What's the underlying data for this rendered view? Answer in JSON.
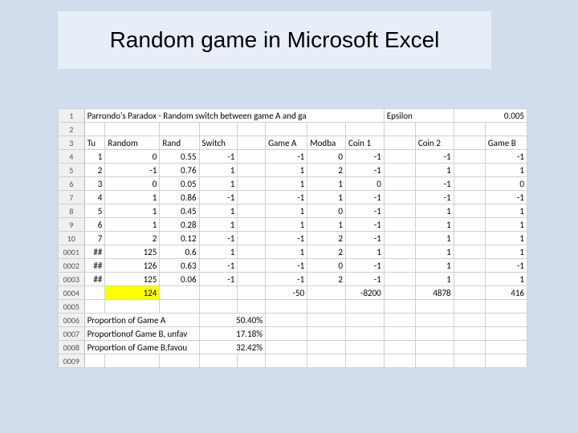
{
  "slide_title": "Random game in Microsoft Excel",
  "row1": {
    "title": "Parrondo's Paradox - Random switch between game A and ga",
    "eps_label": "Epsilon",
    "eps_value": "0.005"
  },
  "hdr": {
    "tu": "Tu",
    "random": "Random",
    "rand": "Rand",
    "switch": "Switch",
    "gameA": "Game A",
    "modba": "Modba",
    "coin1": "Coin 1",
    "coin2": "Coin 2",
    "gameB": "Game B"
  },
  "rows": [
    {
      "rh": "4",
      "tu": "1",
      "rand1": "0",
      "rand2": "0.55",
      "sw": "-1",
      "ga": "-1",
      "mod": "0",
      "c1": "-1",
      "c2": "-1",
      "gb": "-1"
    },
    {
      "rh": "5",
      "tu": "2",
      "rand1": "-1",
      "rand2": "0.76",
      "sw": "1",
      "ga": "1",
      "mod": "2",
      "c1": "-1",
      "c2": "1",
      "gb": "1"
    },
    {
      "rh": "6",
      "tu": "3",
      "rand1": "0",
      "rand2": "0.05",
      "sw": "1",
      "ga": "1",
      "mod": "1",
      "c1": "0",
      "c2": "-1",
      "gb": "0"
    },
    {
      "rh": "7",
      "tu": "4",
      "rand1": "1",
      "rand2": "0.86",
      "sw": "-1",
      "ga": "-1",
      "mod": "1",
      "c1": "-1",
      "c2": "-1",
      "gb": "-1"
    },
    {
      "rh": "8",
      "tu": "5",
      "rand1": "1",
      "rand2": "0.45",
      "sw": "1",
      "ga": "1",
      "mod": "0",
      "c1": "-1",
      "c2": "1",
      "gb": "1"
    },
    {
      "rh": "9",
      "tu": "6",
      "rand1": "1",
      "rand2": "0.28",
      "sw": "1",
      "ga": "1",
      "mod": "1",
      "c1": "-1",
      "c2": "1",
      "gb": "1"
    },
    {
      "rh": "10",
      "tu": "7",
      "rand1": "2",
      "rand2": "0.12",
      "sw": "-1",
      "ga": "-1",
      "mod": "2",
      "c1": "-1",
      "c2": "1",
      "gb": "1"
    },
    {
      "rh": "0001",
      "tu": "##",
      "rand1": "125",
      "rand2": "0.6",
      "sw": "1",
      "ga": "1",
      "mod": "2",
      "c1": "1",
      "c2": "1",
      "gb": "1"
    },
    {
      "rh": "0002",
      "tu": "##",
      "rand1": "126",
      "rand2": "0.63",
      "sw": "-1",
      "ga": "-1",
      "mod": "0",
      "c1": "-1",
      "c2": "1",
      "gb": "-1"
    },
    {
      "rh": "0003",
      "tu": "##",
      "rand1": "125",
      "rand2": "0.06",
      "sw": "-1",
      "ga": "-1",
      "mod": "2",
      "c1": "-1",
      "c2": "1",
      "gb": "1"
    }
  ],
  "totals": {
    "rh": "0004",
    "rand1": "124",
    "ga": "-50",
    "c1": "-8200",
    "c2": "4878",
    "gb": "416"
  },
  "blank": {
    "rh": "0005"
  },
  "stats": [
    {
      "rh": "0006",
      "label": "Proportion of Game A",
      "val": "50.40%"
    },
    {
      "rh": "0007",
      "label": "Proportionof Game B, unfav",
      "val": "17.18%"
    },
    {
      "rh": "0008",
      "label": "Proportion of Game B,favou",
      "val": "32.42%"
    }
  ],
  "tail": {
    "rh": "0009"
  }
}
